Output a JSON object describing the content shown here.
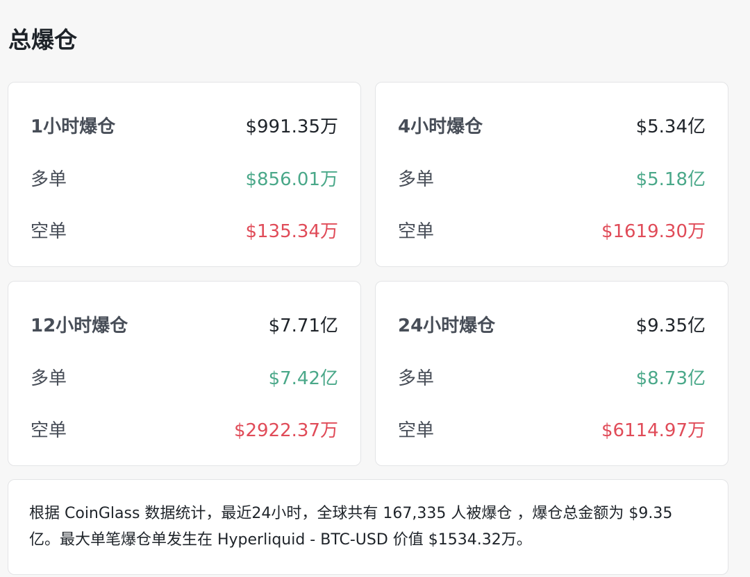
{
  "page": {
    "title": "总爆仓"
  },
  "colors": {
    "long": "#4aa889",
    "short": "#e04b58",
    "text_primary": "#1e2329",
    "text_secondary": "#474d57",
    "card_border": "#e3e4e6",
    "background": "#f7f7f7"
  },
  "cards": [
    {
      "period_label": "1小时爆仓",
      "total": "$991.35万",
      "long_label": "多单",
      "long_value": "$856.01万",
      "short_label": "空单",
      "short_value": "$135.34万"
    },
    {
      "period_label": "4小时爆仓",
      "total": "$5.34亿",
      "long_label": "多单",
      "long_value": "$5.18亿",
      "short_label": "空单",
      "short_value": "$1619.30万"
    },
    {
      "period_label": "12小时爆仓",
      "total": "$7.71亿",
      "long_label": "多单",
      "long_value": "$7.42亿",
      "short_label": "空单",
      "short_value": "$2922.37万"
    },
    {
      "period_label": "24小时爆仓",
      "total": "$9.35亿",
      "long_label": "多单",
      "long_value": "$8.73亿",
      "short_label": "空单",
      "short_value": "$6114.97万"
    }
  ],
  "summary": {
    "text": "根据 CoinGlass 数据统计，最近24小时，全球共有 167,335 人被爆仓 ，爆仓总金额为 $9.35 亿。最大单笔爆仓单发生在 Hyperliquid - BTC-USD 价值 $1534.32万。"
  }
}
